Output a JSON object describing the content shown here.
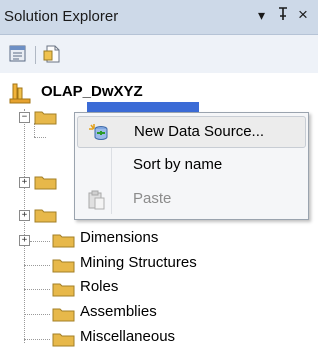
{
  "panel": {
    "title": "Solution Explorer",
    "pin_glyph": "▾ ⊥ ×",
    "dropdown_glyph": "▾",
    "pin_icon": "pin-icon",
    "close_glyph": "×"
  },
  "toolbar": {
    "items": [
      {
        "icon": "properties-icon"
      },
      {
        "icon": "show-all-files-icon"
      }
    ]
  },
  "tree": {
    "root": {
      "label": "OLAP_DwXYZ",
      "icon": "analysis-services-project-icon"
    },
    "nodes": [
      {
        "label": "",
        "icon": "folder-icon",
        "expander": "−"
      },
      {
        "label": "",
        "icon": "folder-icon",
        "expander": "+"
      },
      {
        "label": "",
        "icon": "folder-icon",
        "expander": "+"
      },
      {
        "label": "Dimensions",
        "icon": "folder-icon",
        "expander": "+"
      },
      {
        "label": "Mining Structures",
        "icon": "folder-icon",
        "expander": ""
      },
      {
        "label": "Roles",
        "icon": "folder-icon",
        "expander": ""
      },
      {
        "label": "Assemblies",
        "icon": "folder-icon",
        "expander": ""
      },
      {
        "label": "Miscellaneous",
        "icon": "folder-icon",
        "expander": ""
      }
    ]
  },
  "context_menu": {
    "items": [
      {
        "label": "New Data Source...",
        "icon": "new-data-source-icon",
        "enabled": true,
        "hover": true
      },
      {
        "label": "Sort by name",
        "icon": "",
        "enabled": true,
        "hover": false
      },
      {
        "label": "Paste",
        "icon": "paste-icon",
        "enabled": false,
        "hover": false
      }
    ]
  },
  "colors": {
    "title_bar": "#cdd9e8",
    "selection": "#3b6bd6",
    "folder": "#e7b84a",
    "disabled_text": "#8c8c8c"
  }
}
